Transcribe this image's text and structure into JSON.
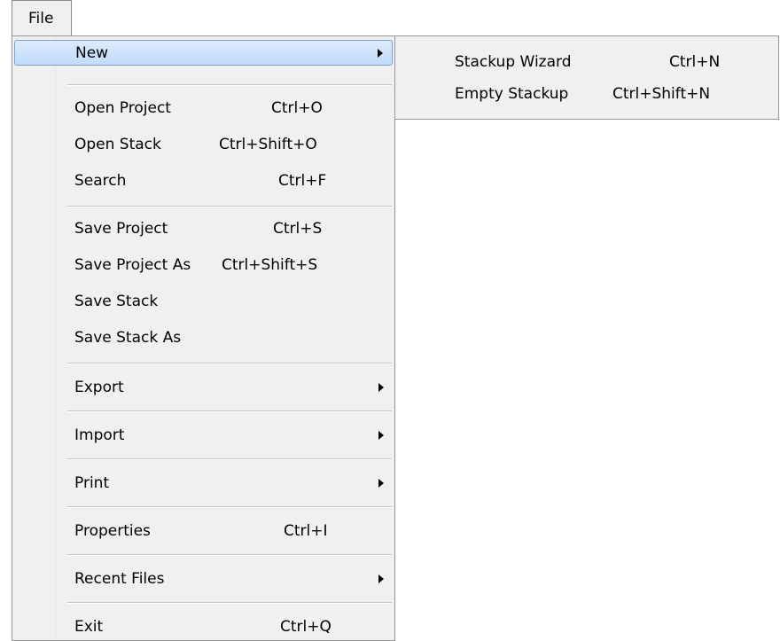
{
  "menubar": {
    "file_label": "File"
  },
  "file_menu": {
    "new": {
      "label": "New"
    },
    "open_project": {
      "label": "Open Project",
      "shortcut": "Ctrl+O"
    },
    "open_stack": {
      "label": "Open Stack",
      "shortcut": "Ctrl+Shift+O"
    },
    "search": {
      "label": "Search",
      "shortcut": "Ctrl+F"
    },
    "save_project": {
      "label": "Save Project",
      "shortcut": "Ctrl+S"
    },
    "save_project_as": {
      "label": "Save Project As",
      "shortcut": "Ctrl+Shift+S"
    },
    "save_stack": {
      "label": "Save Stack"
    },
    "save_stack_as": {
      "label": "Save Stack As"
    },
    "export": {
      "label": "Export"
    },
    "import": {
      "label": "Import"
    },
    "print": {
      "label": "Print"
    },
    "properties": {
      "label": "Properties",
      "shortcut": "Ctrl+I"
    },
    "recent_files": {
      "label": "Recent Files"
    },
    "exit": {
      "label": "Exit",
      "shortcut": "Ctrl+Q"
    }
  },
  "new_submenu": {
    "stackup_wizard": {
      "label": "Stackup Wizard",
      "shortcut": "Ctrl+N"
    },
    "empty_stackup": {
      "label": "Empty Stackup",
      "shortcut": "Ctrl+Shift+N"
    }
  },
  "colors": {
    "menu_background": "#f0f0f0",
    "highlight_top": "#dcebfc",
    "highlight_bottom": "#c1dbfc",
    "highlight_border": "#7da2ce"
  }
}
